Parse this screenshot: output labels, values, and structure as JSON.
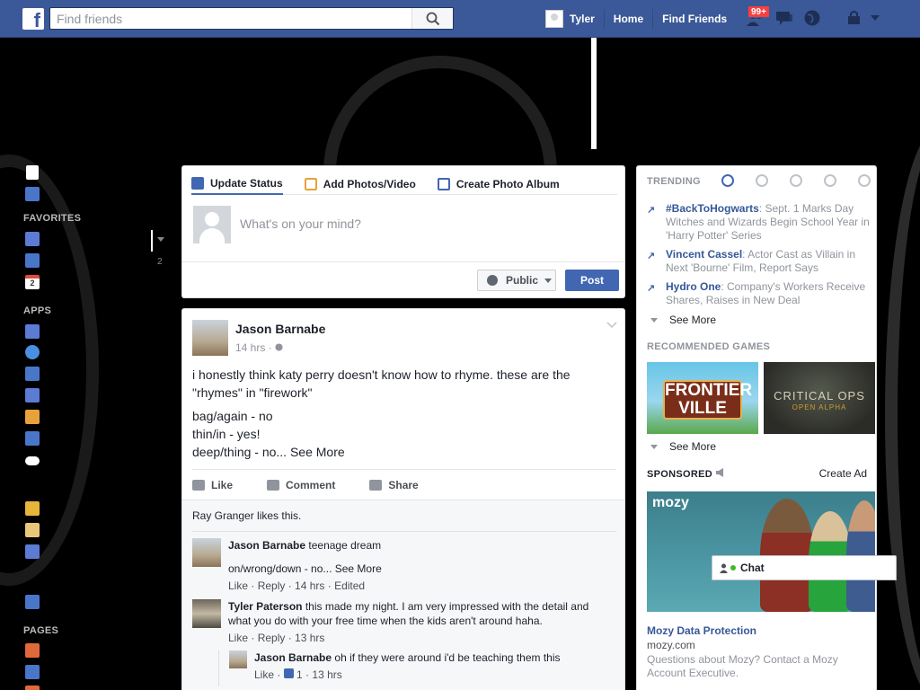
{
  "header": {
    "search_placeholder": "Find friends",
    "user_name": "Tyler",
    "home": "Home",
    "find_friends": "Find Friends",
    "friend_requests_badge": "99+"
  },
  "sidebar": {
    "favorites": "FAVORITES",
    "apps": "APPS",
    "pages": "PAGES",
    "calendar_day": "2",
    "count": "2"
  },
  "composer": {
    "tabs": [
      "Update Status",
      "Add Photos/Video",
      "Create Photo Album"
    ],
    "placeholder": "What's on your mind?",
    "privacy": "Public",
    "post": "Post"
  },
  "story": {
    "author": "Jason Barnabe",
    "time": "14 hrs ·",
    "text_line1": "i honestly think katy perry doesn't know how to rhyme. these are the \"rhymes\" in \"firework\"",
    "text_line2": "bag/again - no",
    "text_line3": "thin/in - yes!",
    "text_line4": "deep/thing - no...",
    "see_more": "See More",
    "actions": [
      "Like",
      "Comment",
      "Share"
    ],
    "likes": "Ray Granger likes this."
  },
  "comments": [
    {
      "author": "Jason Barnabe",
      "text": "teenage dream",
      "text2": "on/wrong/down - no...",
      "see_more": "See More",
      "meta": [
        "Like",
        "Reply",
        "14 hrs",
        "Edited"
      ]
    },
    {
      "author": "Tyler Paterson",
      "text": "this made my night. I am very impressed with the detail and what you do with your free time when the kids aren't around haha.",
      "meta": [
        "Like",
        "Reply",
        "13 hrs"
      ]
    },
    {
      "author": "Jason Barnabe",
      "text": "oh if they were around i'd be teaching them this",
      "meta": [
        "Like",
        "1",
        "13 hrs"
      ]
    }
  ],
  "trending": {
    "header": "TRENDING",
    "items": [
      {
        "topic": "#BackToHogwarts",
        "desc": ": Sept. 1 Marks Day Witches and Wizards Begin School Year in 'Harry Potter' Series"
      },
      {
        "topic": "Vincent Cassel",
        "desc": ": Actor Cast as Villain in Next 'Bourne' Film, Report Says"
      },
      {
        "topic": "Hydro One",
        "desc": ": Company's Workers Receive Shares, Raises in New Deal"
      }
    ],
    "see_more": "See More"
  },
  "games": {
    "header": "RECOMMENDED GAMES",
    "game1": "FRONTIER VILLE",
    "game2_title": "CRITICAL OPS",
    "game2_sub": "OPEN ALPHA",
    "see_more": "See More"
  },
  "sponsored": {
    "header": "SPONSORED",
    "create_ad": "Create Ad",
    "logo": "mozy",
    "title": "Mozy Data Protection",
    "url": "mozy.com",
    "desc": "Questions about Mozy? Contact a Mozy Account Executive."
  },
  "chat": {
    "label": "Chat"
  },
  "colors": {
    "brand": "#3b5998",
    "link": "#365899",
    "button": "#4267b2"
  }
}
